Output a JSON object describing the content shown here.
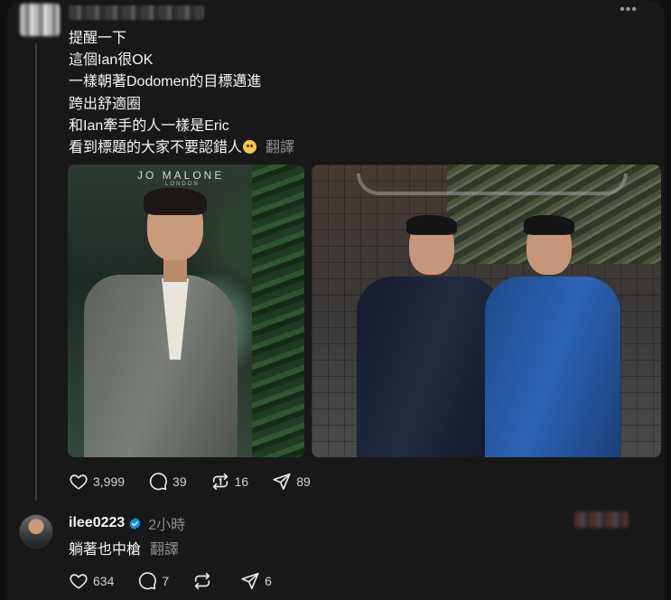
{
  "post": {
    "lines": [
      "提醒一下",
      "這個Ian很OK",
      "一樣朝著Dodomen的目標邁進",
      "跨出舒適圈",
      "和Ian牽手的人一樣是Eric",
      "看到標題的大家不要認錯人"
    ],
    "translate_label": "翻譯",
    "images": [
      {
        "brand": "JO MALONE",
        "brand_sub": "LONDON"
      },
      {}
    ],
    "stats": {
      "likes": "3,999",
      "comments": "39",
      "reposts": "16",
      "shares": "89"
    }
  },
  "reply": {
    "username": "ilee0223",
    "time": "2小時",
    "text": "躺著也中槍",
    "translate_label": "翻譯",
    "stats": {
      "likes": "634",
      "comments": "7",
      "shares": "6"
    }
  },
  "colors": {
    "background": "#181818",
    "text": "#f3f5f7",
    "muted": "#8e8e8e",
    "verified": "#0095f6"
  },
  "icons": [
    "more-icon",
    "heart-icon",
    "comment-icon",
    "repost-icon",
    "share-icon",
    "verified-badge-icon",
    "emoji-icon"
  ]
}
